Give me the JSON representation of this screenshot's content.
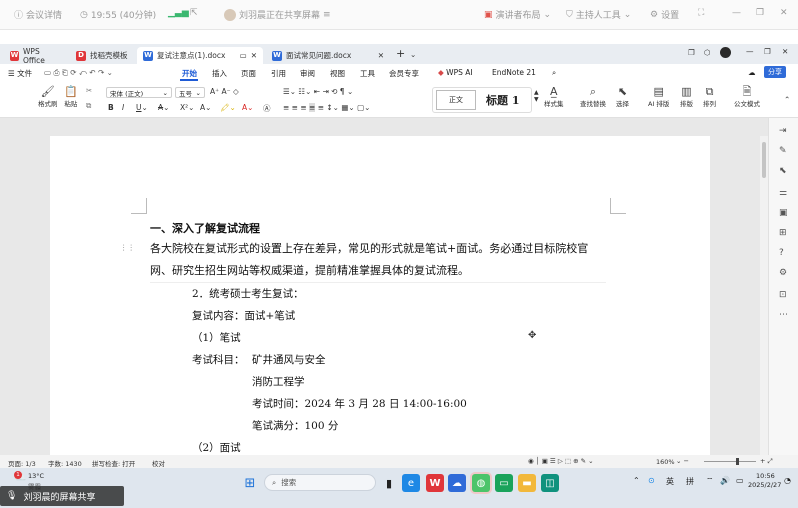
{
  "meeting": {
    "details": "会议详情",
    "time": "19:55 (40分钟)",
    "sharing": "刘羽晨正在共享屏幕",
    "layout": "演讲者布局",
    "host_tools": "主持人工具",
    "settings": "设置"
  },
  "tabs": [
    {
      "label": "WPS Office"
    },
    {
      "label": "找稻壳模板"
    },
    {
      "label": "复试注意点(1).docx"
    },
    {
      "label": "面试常见问题.docx"
    }
  ],
  "menu": {
    "file": "文件",
    "items": [
      "开始",
      "插入",
      "页面",
      "引用",
      "审阅",
      "视图",
      "工具",
      "会员专享"
    ],
    "wps_ai": "WPS AI",
    "endnote": "EndNote 21",
    "share": "分享"
  },
  "ribbon": {
    "format_painter": "格式刷",
    "paste": "粘贴",
    "font_name": "宋体 (正文)",
    "font_size": "五号",
    "style_normal": "正文",
    "style_heading": "标题 1",
    "style_set": "样式集",
    "find_replace": "查找替换",
    "select": "选择",
    "ai_layout": "AI 排版",
    "layout": "排版",
    "arrange": "排列",
    "formula_mode": "公文模式"
  },
  "document": {
    "heading": "一、深入了解复试流程",
    "para_line1": "各大院校在复试形式的设置上存在差异，常见的形式就是笔试+面试。务必通过目标院校官",
    "para_line2": "网、研究生招生网站等权威渠道，提前精准掌握具体的复试流程。",
    "item2": "2．统考硕士考生复试：",
    "content": "复试内容：面试+笔试",
    "written": "（1）笔试",
    "subjects_label": "考试科目：",
    "subject1": "矿井通风与安全",
    "subject2": "消防工程学",
    "exam_time": "考试时间：2024 年 3 月 28 日 14:00-16:00",
    "full_score": "笔试满分：100 分",
    "interview": "（2）面试"
  },
  "status": {
    "page": "页面: 1/3",
    "words": "字数: 1430",
    "spell": "拼写检查: 打开",
    "proof": "校对",
    "zoom": "160%"
  },
  "taskbar": {
    "weather_temp": "13°C",
    "weather_desc": "雾霾",
    "weather_badge": "1",
    "search": "搜索",
    "lang1": "英",
    "lang2": "拼",
    "time": "10:56",
    "date": "2025/2/27",
    "share_banner": "刘羽晨的屏幕共享"
  }
}
